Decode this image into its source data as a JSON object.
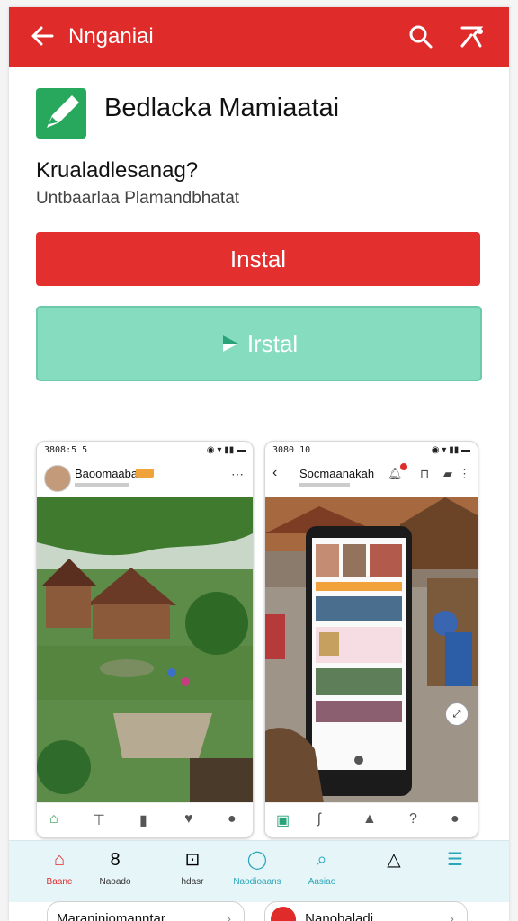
{
  "appbar": {
    "title": "Nnganiai",
    "back_icon": "arrow-left-icon",
    "search_icon": "search-icon",
    "share_icon": "share-icon"
  },
  "app": {
    "name": "Bedlacka Mamiaatai",
    "subtitle": "Krualadlesanag?",
    "description": "Untbaarlaa Plamandbhatat"
  },
  "buttons": {
    "install_primary": "Instal",
    "install_secondary": "Irstal"
  },
  "screenshots": [
    {
      "status_left": "3808:5 5",
      "account": "Baoomaabai"
    },
    {
      "status_left": "3080 10",
      "title": "Socmaanakah"
    }
  ],
  "bottom_tabs": [
    {
      "label": "Baane",
      "icon": "home-icon"
    },
    {
      "label": "Naoado",
      "icon": "bag-icon"
    },
    {
      "label": "hdasr",
      "icon": "inbox-icon"
    },
    {
      "label": "Naodioaans",
      "icon": "chat-icon"
    },
    {
      "label": "Aasiao",
      "icon": "search-icon"
    },
    {
      "label": "",
      "icon": "bell-icon"
    },
    {
      "label": "",
      "icon": "menu-icon"
    }
  ],
  "chips": [
    {
      "label": "Maraniniomanntar"
    },
    {
      "label": "Nanobaladi"
    }
  ],
  "colors": {
    "primary": "#e02b2b",
    "secondary": "#86dcbf",
    "logo": "#28a85c"
  }
}
